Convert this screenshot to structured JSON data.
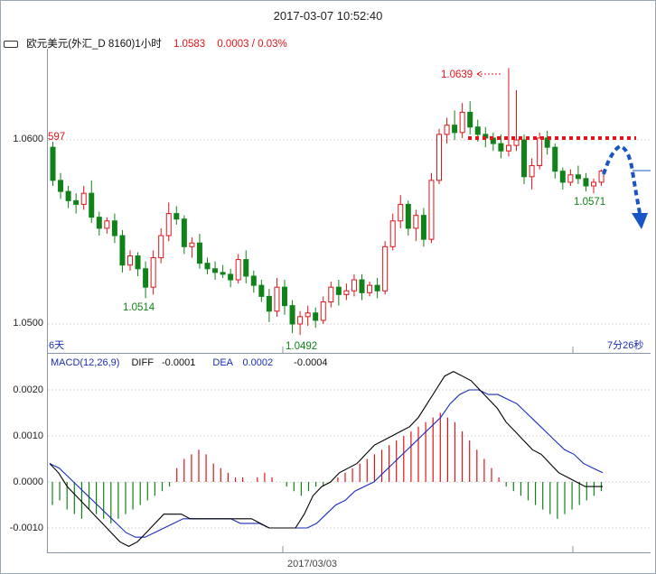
{
  "header": {
    "datetime": "2017-03-07 10:52:40"
  },
  "info": {
    "icon": "link-icon",
    "symbol": "欧元美元(外汇_D 8160)1小时",
    "last": "1.0583",
    "change": "0.0003 / 0.03%"
  },
  "price_panel": {
    "labels": {
      "high": "1.0639",
      "low": "1.0492",
      "left_low": "1.0514",
      "right_low": "1.0571",
      "left_edge": "597",
      "period_left": "6天",
      "period_right": "7分26秒"
    },
    "ticks": [
      "1.0600",
      "1.0500"
    ]
  },
  "macd_panel": {
    "title": "MACD(12,26,9)",
    "diff_label": "DIFF",
    "diff_value": "-0.0001",
    "dea_label": "DEA",
    "dea_value": "0.0002",
    "macd_value": "-0.0004",
    "ticks": [
      "0.0020",
      "0.0010",
      "0.0000",
      "-0.0010"
    ]
  },
  "x_axis": {
    "date_label": "2017/03/03"
  },
  "colors": {
    "up": "#e0141a",
    "down": "#11821a",
    "dea": "#1a2bb8",
    "diff": "#000000",
    "forecast": "#1a55c8",
    "resistance": "#e0141a"
  },
  "chart_data": [
    {
      "type": "candlestick",
      "title": "欧元美元(外汇_D 8160)1小时",
      "ylim": [
        1.0485,
        1.0645
      ],
      "ticks": [
        1.05,
        1.06
      ],
      "candles": [
        [
          1.0596,
          1.0599,
          1.0575,
          1.0578
        ],
        [
          1.0578,
          1.0582,
          1.0568,
          1.0572
        ],
        [
          1.0572,
          1.0575,
          1.0563,
          1.0567
        ],
        [
          1.0567,
          1.0571,
          1.056,
          1.0565
        ],
        [
          1.0565,
          1.0575,
          1.0562,
          1.0571
        ],
        [
          1.0571,
          1.0578,
          1.0555,
          1.0558
        ],
        [
          1.0558,
          1.0561,
          1.0548,
          1.0552
        ],
        [
          1.0552,
          1.0558,
          1.0549,
          1.0556
        ],
        [
          1.0556,
          1.056,
          1.0544,
          1.0548
        ],
        [
          1.0548,
          1.0551,
          1.0528,
          1.0532
        ],
        [
          1.0532,
          1.054,
          1.0529,
          1.0537
        ],
        [
          1.0537,
          1.0539,
          1.0526,
          1.053
        ],
        [
          1.053,
          1.0534,
          1.0514,
          1.052
        ],
        [
          1.052,
          1.054,
          1.0516,
          1.0536
        ],
        [
          1.0536,
          1.0552,
          1.0533,
          1.0548
        ],
        [
          1.0548,
          1.0566,
          1.0545,
          1.056
        ],
        [
          1.056,
          1.0564,
          1.0554,
          1.0557
        ],
        [
          1.0557,
          1.0559,
          1.0538,
          1.0542
        ],
        [
          1.0542,
          1.0547,
          1.0536,
          1.0544
        ],
        [
          1.0544,
          1.0549,
          1.053,
          1.0533
        ],
        [
          1.0533,
          1.0536,
          1.0527,
          1.053
        ],
        [
          1.053,
          1.0534,
          1.0524,
          1.0528
        ],
        [
          1.0528,
          1.0532,
          1.0525,
          1.0527
        ],
        [
          1.0527,
          1.053,
          1.052,
          1.0524
        ],
        [
          1.0524,
          1.0538,
          1.0522,
          1.0535
        ],
        [
          1.0535,
          1.054,
          1.0522,
          1.0526
        ],
        [
          1.0526,
          1.0529,
          1.0517,
          1.0521
        ],
        [
          1.0521,
          1.0524,
          1.0512,
          1.0515
        ],
        [
          1.0515,
          1.0519,
          1.0501,
          1.0507
        ],
        [
          1.0507,
          1.0525,
          1.0504,
          1.052
        ],
        [
          1.052,
          1.0524,
          1.0505,
          1.051
        ],
        [
          1.051,
          1.0513,
          1.0495,
          1.05
        ],
        [
          1.05,
          1.0507,
          1.0494,
          1.0504
        ],
        [
          1.0504,
          1.051,
          1.0499,
          1.0506
        ],
        [
          1.0506,
          1.0509,
          1.0498,
          1.0502
        ],
        [
          1.0502,
          1.0515,
          1.05,
          1.0512
        ],
        [
          1.0512,
          1.0523,
          1.0509,
          1.052
        ],
        [
          1.052,
          1.0524,
          1.051,
          1.0516
        ],
        [
          1.0516,
          1.0522,
          1.0513,
          1.0518
        ],
        [
          1.0518,
          1.0527,
          1.0515,
          1.0524
        ],
        [
          1.0524,
          1.0527,
          1.0513,
          1.0517
        ],
        [
          1.0517,
          1.0523,
          1.0515,
          1.0521
        ],
        [
          1.0521,
          1.0525,
          1.0514,
          1.0518
        ],
        [
          1.0518,
          1.0545,
          1.0516,
          1.0542
        ],
        [
          1.0542,
          1.056,
          1.054,
          1.0556
        ],
        [
          1.0556,
          1.057,
          1.0552,
          1.0565
        ],
        [
          1.0565,
          1.0567,
          1.0548,
          1.0552
        ],
        [
          1.0552,
          1.0562,
          1.0545,
          1.0559
        ],
        [
          1.0559,
          1.0563,
          1.0542,
          1.0546
        ],
        [
          1.0546,
          1.0582,
          1.0544,
          1.0578
        ],
        [
          1.0578,
          1.0606,
          1.0576,
          1.0603
        ],
        [
          1.0603,
          1.0612,
          1.0598,
          1.0608
        ],
        [
          1.0608,
          1.0616,
          1.06,
          1.0604
        ],
        [
          1.0604,
          1.062,
          1.0601,
          1.0615
        ],
        [
          1.0615,
          1.0621,
          1.0603,
          1.0607
        ],
        [
          1.0607,
          1.0611,
          1.0599,
          1.0603
        ],
        [
          1.0603,
          1.0607,
          1.0596,
          1.0601
        ],
        [
          1.0601,
          1.0604,
          1.0594,
          1.0598
        ],
        [
          1.0598,
          1.0603,
          1.059,
          1.0594
        ],
        [
          1.0594,
          1.0639,
          1.0591,
          1.0597
        ],
        [
          1.0597,
          1.0627,
          1.0594,
          1.06
        ],
        [
          1.06,
          1.0603,
          1.0576,
          1.058
        ],
        [
          1.058,
          1.059,
          1.0573,
          1.0586
        ],
        [
          1.0586,
          1.0604,
          1.0584,
          1.0601
        ],
        [
          1.0601,
          1.0605,
          1.0592,
          1.0596
        ],
        [
          1.0596,
          1.0598,
          1.0579,
          1.0583
        ],
        [
          1.0583,
          1.0585,
          1.0573,
          1.0577
        ],
        [
          1.0577,
          1.0584,
          1.0575,
          1.0581
        ],
        [
          1.0581,
          1.0586,
          1.0576,
          1.0579
        ],
        [
          1.0579,
          1.0582,
          1.0572,
          1.0575
        ],
        [
          1.0575,
          1.0579,
          1.0571,
          1.0577
        ],
        [
          1.0577,
          1.0584,
          1.0575,
          1.0583
        ]
      ],
      "annotations": {
        "high": 1.0639,
        "low": 1.0492,
        "left_low": 1.0514,
        "right_low": 1.0571,
        "resistance": 1.06
      }
    },
    {
      "type": "macd",
      "title": "MACD(12,26,9)",
      "ylim": [
        -0.0015,
        0.0025
      ],
      "ticks": [
        0.002,
        0.001,
        0.0,
        -0.001
      ],
      "hist": [
        -0.0005,
        -0.0004,
        -0.0006,
        -0.0007,
        -0.0008,
        -0.0006,
        -0.0007,
        -0.0008,
        -0.0009,
        -0.0008,
        -0.0007,
        -0.0006,
        -0.0005,
        -0.0004,
        -0.0003,
        -0.0002,
        -0.0001,
        0.0003,
        0.0005,
        0.0006,
        0.0007,
        0.0006,
        0.0004,
        0.0003,
        0.0002,
        0.0001,
        0.0001,
        0.0,
        0.0001,
        0.0002,
        0.0001,
        0.0,
        -0.0001,
        -0.0002,
        -0.0003,
        -0.0002,
        -0.0001,
        -0.0001,
        0.0,
        0.0001,
        0.0002,
        0.0003,
        0.0004,
        0.0005,
        0.0006,
        0.0007,
        0.0008,
        0.0009,
        0.001,
        0.0011,
        0.0012,
        0.0013,
        0.0014,
        0.0015,
        0.0014,
        0.0013,
        0.0011,
        0.0009,
        0.0007,
        0.0005,
        0.0003,
        0.0001,
        -0.0001,
        -0.0002,
        -0.0003,
        -0.0004,
        -0.0005,
        -0.0006,
        -0.0007,
        -0.0008,
        -0.0007,
        -0.0006,
        -0.0005,
        -0.0004,
        -0.0003,
        -0.0002
      ],
      "diff": [
        0.0004,
        0.0002,
        -0.0001,
        -0.0003,
        -0.0005,
        -0.0007,
        -0.0009,
        -0.0011,
        -0.0013,
        -0.0014,
        -0.0013,
        -0.0011,
        -0.0009,
        -0.0007,
        -0.0007,
        -0.0007,
        -0.0008,
        -0.0008,
        -0.0008,
        -0.0008,
        -0.0008,
        -0.0008,
        -0.0008,
        -0.0008,
        -0.0009,
        -0.001,
        -0.001,
        -0.001,
        -0.001,
        -0.0007,
        -0.0003,
        -0.0001,
        0.0,
        0.0002,
        0.0003,
        0.0004,
        0.0006,
        0.0008,
        0.0009,
        0.001,
        0.0011,
        0.0012,
        0.0014,
        0.0017,
        0.002,
        0.0023,
        0.0024,
        0.0023,
        0.0022,
        0.002,
        0.0018,
        0.0016,
        0.0013,
        0.0011,
        0.0009,
        0.0007,
        0.0006,
        0.0004,
        0.0002,
        0.0001,
        0.0,
        -0.0001,
        -0.0001,
        -0.0001
      ],
      "dea": [
        0.0004,
        0.0003,
        0.0001,
        -0.0001,
        -0.0003,
        -0.0005,
        -0.0007,
        -0.0009,
        -0.0011,
        -0.0012,
        -0.0012,
        -0.0011,
        -0.001,
        -0.0009,
        -0.0008,
        -0.0008,
        -0.0008,
        -0.0008,
        -0.0008,
        -0.0008,
        -0.0009,
        -0.0009,
        -0.0009,
        -0.001,
        -0.001,
        -0.001,
        -0.001,
        -0.001,
        -0.0009,
        -0.0007,
        -0.0005,
        -0.0004,
        -0.0002,
        -0.0001,
        0.0,
        0.0002,
        0.0004,
        0.0006,
        0.0008,
        0.001,
        0.0012,
        0.0014,
        0.0017,
        0.0019,
        0.002,
        0.002,
        0.0019,
        0.0019,
        0.0018,
        0.0017,
        0.0015,
        0.0013,
        0.0011,
        0.0009,
        0.0007,
        0.0006,
        0.0004,
        0.0003,
        0.0002
      ]
    }
  ]
}
